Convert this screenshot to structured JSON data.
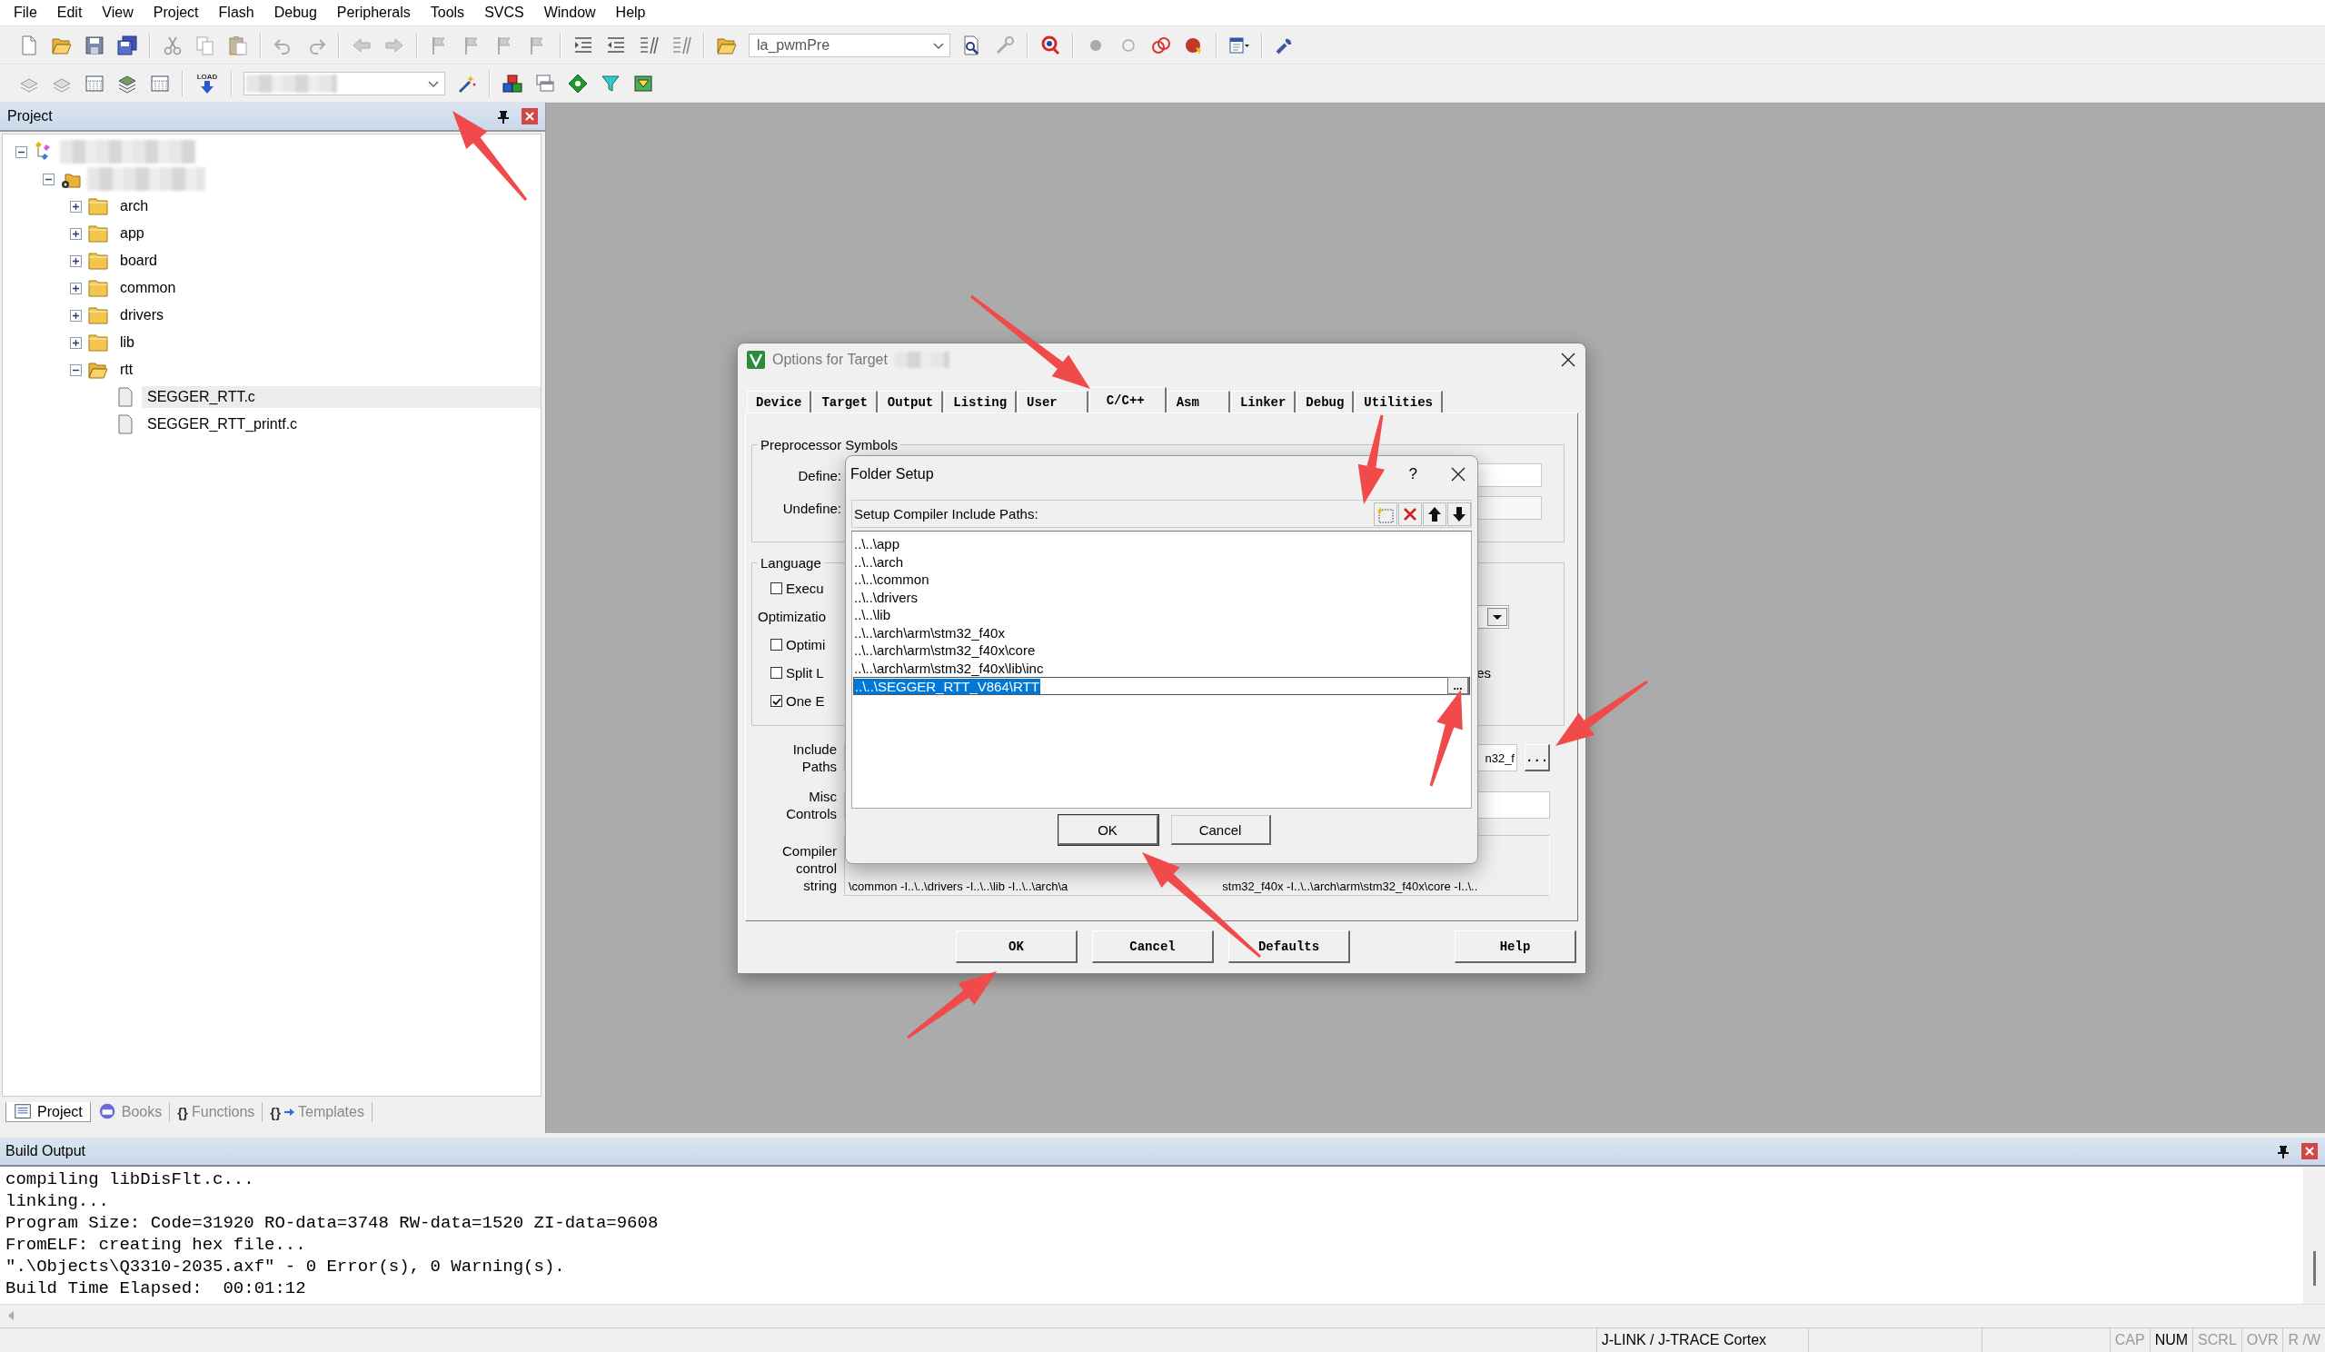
{
  "menu": [
    "File",
    "Edit",
    "View",
    "Project",
    "Flash",
    "Debug",
    "Peripherals",
    "Tools",
    "SVCS",
    "Window",
    "Help"
  ],
  "toolbar": {
    "target_combo": "la_pwmPre",
    "load_label": "LOAD"
  },
  "project_panel": {
    "title": "Project",
    "tree": [
      {
        "kind": "project",
        "expanded": true,
        "children": [
          {
            "kind": "target",
            "expanded": true,
            "children": [
              {
                "kind": "group",
                "label": "arch",
                "expanded": false
              },
              {
                "kind": "group",
                "label": "app",
                "expanded": false
              },
              {
                "kind": "group",
                "label": "board",
                "expanded": false
              },
              {
                "kind": "group",
                "label": "common",
                "expanded": false
              },
              {
                "kind": "group",
                "label": "drivers",
                "expanded": false
              },
              {
                "kind": "group",
                "label": "lib",
                "expanded": false
              },
              {
                "kind": "group",
                "label": "rtt",
                "expanded": true,
                "children": [
                  {
                    "kind": "file",
                    "label": "SEGGER_RTT.c",
                    "selected": true
                  },
                  {
                    "kind": "file",
                    "label": "SEGGER_RTT_printf.c",
                    "selected": false
                  }
                ]
              }
            ]
          }
        ]
      }
    ],
    "tabs": [
      {
        "kind": "project",
        "label": "Project",
        "selected": true
      },
      {
        "kind": "books",
        "label": "Books",
        "selected": false
      },
      {
        "kind": "functions",
        "glyph": "{}",
        "label": "Functions",
        "selected": false
      },
      {
        "kind": "templates",
        "glyph": "{}",
        "label": "Templates",
        "selected": false
      }
    ]
  },
  "options_dialog": {
    "title": "Options for Target",
    "tabs": [
      {
        "label": "Device",
        "selected": false
      },
      {
        "label": "Target",
        "selected": false
      },
      {
        "label": "Output",
        "selected": false
      },
      {
        "label": "Listing",
        "selected": false
      },
      {
        "label": "User",
        "selected": false
      },
      {
        "label": "C/C++",
        "selected": true
      },
      {
        "label": "Asm",
        "selected": false
      },
      {
        "label": "Linker",
        "selected": false
      },
      {
        "label": "Debug",
        "selected": false
      },
      {
        "label": "Utilities",
        "selected": false
      }
    ],
    "preprocessor": {
      "title": "Preprocessor Symbols",
      "define_label": "Define:",
      "undefine_label": "Undefine:"
    },
    "language": {
      "title": "Language",
      "options": [
        {
          "kind": "checkbox",
          "label": "Execu",
          "checked": false
        },
        {
          "kind": "select",
          "label": "Optimizatio"
        },
        {
          "kind": "checkbox",
          "label": "Optimi",
          "checked": false
        },
        {
          "kind": "checkbox",
          "label": "Split L",
          "checked": false,
          "right_text": "es"
        },
        {
          "kind": "checkbox",
          "label": "One E",
          "checked": true
        }
      ]
    },
    "include_paths": {
      "label": "Include Paths",
      "value": "n32_f",
      "browse": "..."
    },
    "misc_controls": {
      "label": "Misc Controls"
    },
    "compiler_string": {
      "label": "Compiler control string",
      "value_parts": [
        "\\common -I..\\..\\drivers -I..\\..\\lib -I..\\..\\arch\\a",
        "stm32_f40x -I..\\..\\arch\\arm\\stm32_f40x\\core -I..\\.."
      ]
    },
    "buttons": [
      "OK",
      "Cancel",
      "Defaults",
      "Help"
    ]
  },
  "folder_setup": {
    "title": "Folder Setup",
    "help": "?",
    "header": "Setup Compiler Include Paths:",
    "paths": [
      {
        "text": "..\\..\\app",
        "selected": false
      },
      {
        "text": "..\\..\\arch",
        "selected": false
      },
      {
        "text": "..\\..\\common",
        "selected": false
      },
      {
        "text": "..\\..\\drivers",
        "selected": false
      },
      {
        "text": "..\\..\\lib",
        "selected": false
      },
      {
        "text": "..\\..\\arch\\arm\\stm32_f40x",
        "selected": false
      },
      {
        "text": "..\\..\\arch\\arm\\stm32_f40x\\core",
        "selected": false
      },
      {
        "text": "..\\..\\arch\\arm\\stm32_f40x\\lib\\inc",
        "selected": false
      },
      {
        "text": "..\\..\\SEGGER_RTT_V864\\RTT",
        "selected": true
      }
    ],
    "browse": "...",
    "buttons": [
      "OK",
      "Cancel"
    ]
  },
  "build_output": {
    "title": "Build Output",
    "lines": [
      "compiling libDisFlt.c...",
      "linking...",
      "Program Size: Code=31920 RO-data=3748 RW-data=1520 ZI-data=9608",
      "FromELF: creating hex file...",
      "\".\\Objects\\Q3310-2035.axf\" - 0 Error(s), 0 Warning(s).",
      "Build Time Elapsed:  00:01:12"
    ]
  },
  "status_bar": {
    "target": "J-LINK / J-TRACE Cortex",
    "indicators": [
      {
        "label": "CAP",
        "on": false
      },
      {
        "label": "NUM",
        "on": true
      },
      {
        "label": "SCRL",
        "on": false
      },
      {
        "label": "OVR",
        "on": false
      },
      {
        "label": "R /W",
        "on": false
      }
    ]
  }
}
